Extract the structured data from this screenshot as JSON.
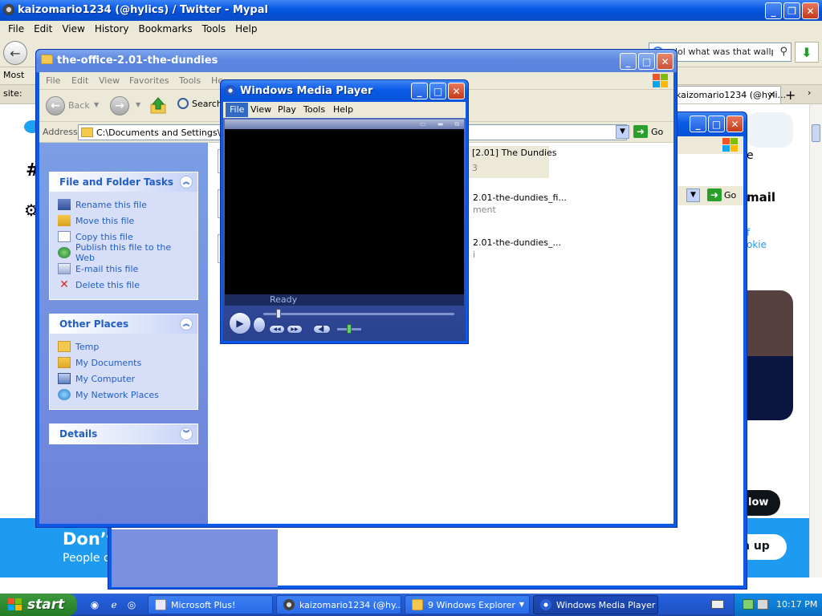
{
  "browser": {
    "title": "kaizomario1234 (@hylics) / Twitter - Mypal",
    "menu": [
      "File",
      "Edit",
      "View",
      "History",
      "Bookmarks",
      "Tools",
      "Help"
    ],
    "search_value": "lol what was that wallpap",
    "bookmark_label": "Most",
    "tab1_label": "site:",
    "tab2_label": "kaizomario1234 (@hyli...",
    "tab_close": "×",
    "new_tab": "+",
    "more_tabs": "›"
  },
  "twitter": {
    "hash": "#",
    "e_fragment": "e",
    "mail_fragment": "mail",
    "link1": "f",
    "link2": "okie",
    "follow_label": "low",
    "banner_heading": "Don’t",
    "banner_sub": "People o",
    "signup_label": "n up"
  },
  "explorer": {
    "title": "the-office-2.01-the-dundies",
    "menu": [
      "File",
      "Edit",
      "View",
      "Favorites",
      "Tools",
      "He"
    ],
    "back_label": "Back",
    "search_label": "Search",
    "address_label": "Address",
    "address_path": "C:\\Documents and Settings\\VM2",
    "go_label": "Go",
    "tasks_panel": {
      "title": "File and Folder Tasks",
      "items": [
        "Rename this file",
        "Move this file",
        "Copy this file",
        "Publish this file to the Web",
        "E-mail this file",
        "Delete this file"
      ]
    },
    "places_panel": {
      "title": "Other Places",
      "items": [
        "Temp",
        "My Documents",
        "My Computer",
        "My Network Places"
      ]
    },
    "details_panel": {
      "title": "Details"
    },
    "files": [
      {
        "name": "[2.01] The Dundies",
        "sub": "3"
      },
      {
        "name": "2.01-the-dundies_fi...",
        "sub": "ment"
      },
      {
        "name": "2.01-the-dundies_...",
        "sub": "i"
      }
    ]
  },
  "bg_explorer": {
    "go_label": "Go"
  },
  "wmp": {
    "title": "Windows Media Player",
    "menu": [
      "File",
      "View",
      "Play",
      "Tools",
      "Help"
    ],
    "status": "Ready",
    "seek_position": 0.07,
    "volume_level": 0.5
  },
  "taskbar": {
    "start_label": "start",
    "buttons": [
      {
        "label": "Microsoft Plus!"
      },
      {
        "label": "kaizomario1234 (@hy..."
      },
      {
        "label": "9 Windows Explorer"
      },
      {
        "label": "Windows Media Player"
      }
    ],
    "clock": "10:17 PM"
  },
  "colors": {
    "xp_title_blue": "#0a5ae6",
    "twitter_blue": "#1d9bf0",
    "link_blue": "#215dc6",
    "start_green": "#2f8a2f"
  }
}
